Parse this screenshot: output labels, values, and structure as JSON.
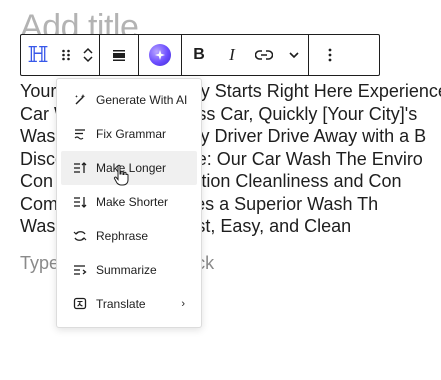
{
  "editor": {
    "title_placeholder": "Add title",
    "paragraph_lines": [
      "Your Car Wash Journey Starts Right Here Experience",
      "Car Wash Like Stainless Car, Quickly [Your City]'s",
      "Wash Ease Your Happy Driver Drive Away with a B",
      "Discover the Difference: Our Car Wash The Enviro",
      "Con Friendly Wash Option Cleanliness and Con",
      "Com Your Car Deserves a Superior Wash Th",
      "Was h Experience: Fast, Easy, and Clean"
    ],
    "block_placeholder": "Type / to choose a block"
  },
  "toolbar": {
    "block_type_icon": "heading-icon",
    "drag_icon": "drag-handle-icon",
    "align_icon": "align-none-icon",
    "ai_icon": "ai-assistant-icon",
    "bold_label": "B",
    "italic_label": "I",
    "link_icon": "link-icon",
    "more_icon": "chevron-down-icon",
    "options_icon": "more-vertical-icon",
    "accent_color": "#3858e9"
  },
  "ai_menu": {
    "items": [
      {
        "label": "Generate With AI",
        "icon": "magic-wand-icon"
      },
      {
        "label": "Fix Grammar",
        "icon": "fix-grammar-icon"
      },
      {
        "label": "Make Longer",
        "icon": "make-longer-icon"
      },
      {
        "label": "Make Shorter",
        "icon": "make-shorter-icon"
      },
      {
        "label": "Rephrase",
        "icon": "rephrase-icon"
      },
      {
        "label": "Summarize",
        "icon": "summarize-icon"
      },
      {
        "label": "Translate",
        "icon": "translate-icon",
        "submenu_indicator": "›"
      }
    ]
  }
}
